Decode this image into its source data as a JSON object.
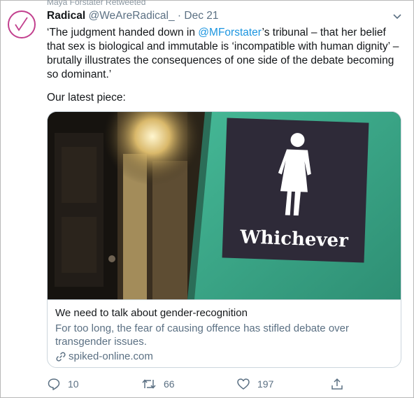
{
  "retweet_context": "Maya Forstater Retweeted",
  "tweet": {
    "name": "Radical",
    "handle": "@WeAreRadical_",
    "separator": " · ",
    "date": "Dec 21",
    "text_parts": [
      "‘The judgment handed down in ",
      "@MForstater",
      "’s tribunal – that her belief that sex is biological and immutable is ‘incompatible with human dignity’ – brutally illustrates the consequences of one side of the debate becoming so dominant.’"
    ],
    "latest_text": "Our latest piece:"
  },
  "card": {
    "image_sign_text": "Whichever",
    "title": "We need to talk about gender-recognition",
    "description": "For too long, the fear of causing offence has stifled debate over transgender issues.",
    "domain": "spiked-online.com",
    "link_icon": "link-icon"
  },
  "actions": {
    "reply_count": "10",
    "retweet_count": "66",
    "like_count": "197",
    "reply_icon": "reply-icon",
    "retweet_icon": "retweet-icon",
    "like_icon": "heart-icon",
    "share_icon": "share-icon"
  },
  "colors": {
    "brand": "#c2408e",
    "link": "#1b95e0",
    "muted": "#5b7083",
    "sign_bg": "#2e2a38",
    "wall": "#3aa98a"
  }
}
